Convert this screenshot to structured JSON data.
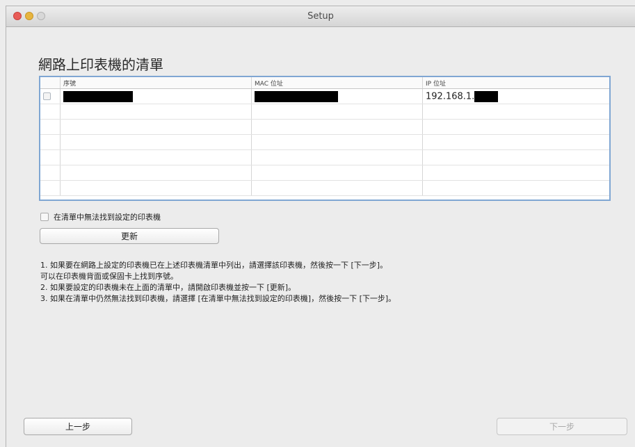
{
  "window": {
    "title": "Setup"
  },
  "page": {
    "heading": "網路上印表機的清單"
  },
  "table": {
    "columns": [
      "序號",
      "MAC 位址",
      "IP 位址"
    ],
    "rows": [
      {
        "serial": "",
        "mac": "",
        "ip_prefix": "192.168.1."
      }
    ],
    "empty_row_count": 6
  },
  "not_found_checkbox": {
    "label": "在清單中無法找到設定的印表機",
    "checked": false
  },
  "buttons": {
    "refresh": "更新",
    "back": "上一步",
    "next": "下一步"
  },
  "instructions": [
    "1. 如果要在網路上設定的印表機已在上述印表機清單中列出，請選擇該印表機，然後按一下 [下一步]。",
    "可以在印表機背面或保固卡上找到序號。",
    "2. 如果要設定的印表機未在上面的清單中，請開啟印表機並按一下 [更新]。",
    "3. 如果在清單中仍然無法找到印表機，請選擇 [在清單中無法找到設定的印表機]，然後按一下 [下一步]。"
  ]
}
